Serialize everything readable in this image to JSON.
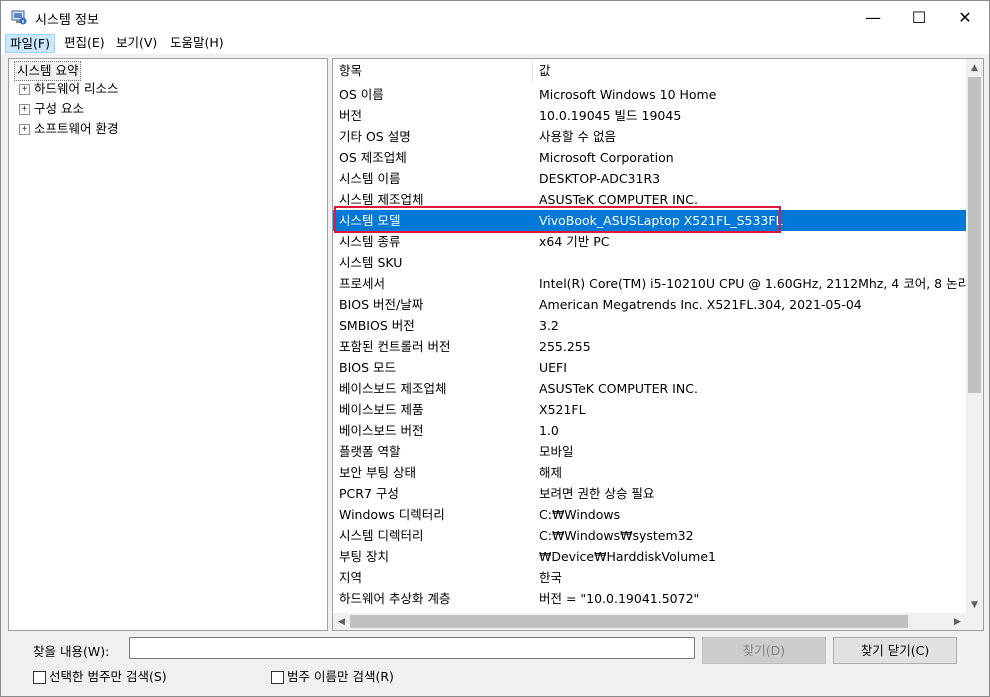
{
  "window": {
    "title": "시스템 정보",
    "min_glyph": "—",
    "max_glyph": "☐",
    "close_glyph": "✕"
  },
  "menu": {
    "items": [
      {
        "label": "파일(F)"
      },
      {
        "label": "편집(E)"
      },
      {
        "label": "보기(V)"
      },
      {
        "label": "도움말(H)"
      }
    ]
  },
  "tree": {
    "root": "시스템 요약",
    "nodes": [
      {
        "expander": "+",
        "label": "하드웨어 리소스"
      },
      {
        "expander": "+",
        "label": "구성 요소"
      },
      {
        "expander": "+",
        "label": "소프트웨어 환경"
      }
    ]
  },
  "list": {
    "col_item": "항목",
    "col_value": "값",
    "rows": [
      {
        "item": "OS 이름",
        "value": "Microsoft Windows 10 Home"
      },
      {
        "item": "버전",
        "value": "10.0.19045 빌드 19045"
      },
      {
        "item": "기타 OS 설명",
        "value": "사용할 수 없음"
      },
      {
        "item": "OS 제조업체",
        "value": "Microsoft Corporation"
      },
      {
        "item": "시스템 이름",
        "value": "DESKTOP-ADC31R3"
      },
      {
        "item": "시스템 제조업체",
        "value": "ASUSTeK COMPUTER INC."
      },
      {
        "item": "시스템 모델",
        "value": "VivoBook_ASUSLaptop X521FL_S533FL"
      },
      {
        "item": "시스템 종류",
        "value": "x64 기반 PC"
      },
      {
        "item": "시스템 SKU",
        "value": ""
      },
      {
        "item": "프로세서",
        "value": "Intel(R) Core(TM) i5-10210U CPU @ 1.60GHz, 2112Mhz, 4 코어, 8 논리"
      },
      {
        "item": "BIOS 버전/날짜",
        "value": "American Megatrends Inc. X521FL.304, 2021-05-04"
      },
      {
        "item": "SMBIOS 버전",
        "value": "3.2"
      },
      {
        "item": "포함된 컨트롤러 버전",
        "value": "255.255"
      },
      {
        "item": "BIOS 모드",
        "value": "UEFI"
      },
      {
        "item": "베이스보드 제조업체",
        "value": "ASUSTeK COMPUTER INC."
      },
      {
        "item": "베이스보드 제품",
        "value": "X521FL"
      },
      {
        "item": "베이스보드 버전",
        "value": "1.0"
      },
      {
        "item": "플랫폼 역할",
        "value": "모바일"
      },
      {
        "item": "보안 부팅 상태",
        "value": "해제"
      },
      {
        "item": "PCR7 구성",
        "value": "보려면 권한 상승 필요"
      },
      {
        "item": "Windows 디렉터리",
        "value": "C:₩Windows"
      },
      {
        "item": "시스템 디렉터리",
        "value": "C:₩Windows₩system32"
      },
      {
        "item": "부팅 장치",
        "value": "₩Device₩HarddiskVolume1"
      },
      {
        "item": "지역",
        "value": "한국"
      },
      {
        "item": "하드웨어 추상화 계층",
        "value": "버전 = \"10.0.19041.5072\""
      }
    ],
    "selected_index": 6
  },
  "find": {
    "label": "찾을 내용(W):",
    "input_value": "",
    "find_button": "찾기(D)",
    "close_button": "찾기 닫기(C)",
    "check_selected_category": "선택한 범주만 검색(S)",
    "check_category_names": "범주 이름만 검색(R)"
  },
  "colors": {
    "selection": "#0078d7",
    "highlight_box": "#e0183c",
    "menu_active": "#cce8ff"
  }
}
